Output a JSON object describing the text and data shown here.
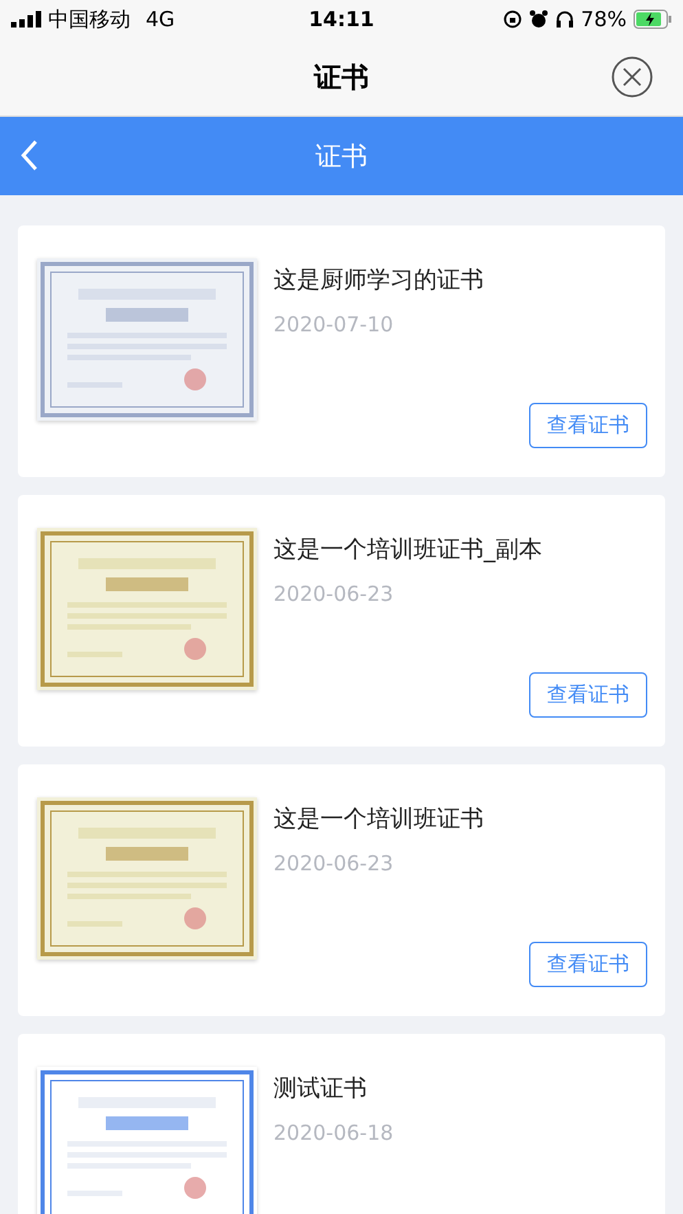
{
  "status_bar": {
    "carrier": "中国移动",
    "network": "4G",
    "time": "14:11",
    "battery": "78%"
  },
  "header": {
    "title": "证书"
  },
  "nav_bar": {
    "title": "证书"
  },
  "certificates": [
    {
      "title": "这是厨师学习的证书",
      "date": "2020-07-10",
      "button": "查看证书"
    },
    {
      "title": "这是一个培训班证书_副本",
      "date": "2020-06-23",
      "button": "查看证书"
    },
    {
      "title": "这是一个培训班证书",
      "date": "2020-06-23",
      "button": "查看证书"
    },
    {
      "title": "测试证书",
      "date": "2020-06-18"
    }
  ]
}
